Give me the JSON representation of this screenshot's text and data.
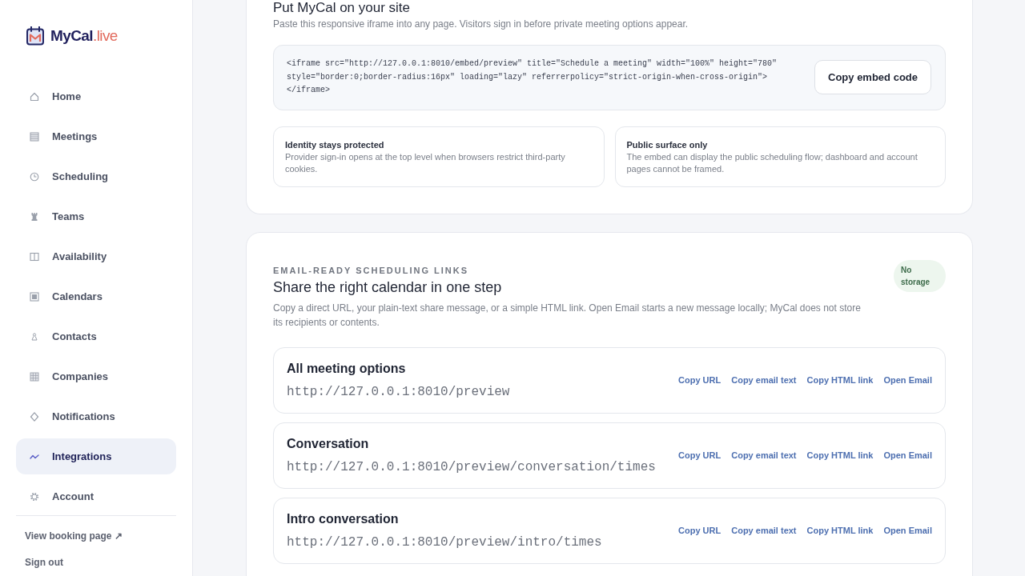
{
  "sidebar": {
    "logo": {
      "name": "MyCal",
      "suffix": ".live"
    },
    "items": [
      {
        "label": "Home",
        "selected": false
      },
      {
        "label": "Meetings",
        "selected": false
      },
      {
        "label": "Scheduling",
        "selected": false
      },
      {
        "label": "Teams",
        "selected": false
      },
      {
        "label": "Availability",
        "selected": false
      },
      {
        "label": "Calendars",
        "selected": false
      },
      {
        "label": "Contacts",
        "selected": false
      },
      {
        "label": "Companies",
        "selected": false
      },
      {
        "label": "Notifications",
        "selected": false
      },
      {
        "label": "Integrations",
        "selected": true
      },
      {
        "label": "Account",
        "selected": false
      }
    ],
    "links": [
      "View booking page ↗",
      "Sign out"
    ]
  },
  "embed": {
    "title": "Put MyCal on your site",
    "description": "Paste this responsive iframe into any page. Visitors sign in before private meeting options appear.",
    "code": "<iframe src=\"http://127.0.0.1:8010/embed/preview\" title=\"Schedule a meeting\" width=\"100%\" height=\"780\" style=\"border:0;border-radius:16px\" loading=\"lazy\" referrerpolicy=\"strict-origin-when-cross-origin\">\n</iframe>",
    "button": "Copy embed code",
    "notes": [
      {
        "title": "Identity stays protected",
        "text": "Provider sign-in opens at the top level when browsers restrict third-party cookies."
      },
      {
        "title": "Public surface only",
        "text": "The embed can display the public scheduling flow; dashboard and account pages cannot be framed."
      }
    ]
  },
  "share": {
    "eyebrow": "EMAIL-READY SCHEDULING LINKS",
    "title": "Share the right calendar in one step",
    "description": "Copy a direct URL, your plain-text share message, or a simple HTML link. Open Email starts a new message locally; MyCal does not store its recipients or contents.",
    "badge": "No storage",
    "rows": [
      {
        "title": "All meeting options",
        "url": "http://127.0.0.1:8010/preview",
        "actions": [
          "Copy URL",
          "Copy email text",
          "Copy HTML link",
          "Open Email"
        ]
      },
      {
        "title": "Conversation",
        "url": "http://127.0.0.1:8010/preview/conversation/times",
        "actions": [
          "Copy URL",
          "Copy email text",
          "Copy HTML link",
          "Open Email"
        ]
      },
      {
        "title": "Intro conversation",
        "url": "http://127.0.0.1:8010/preview/intro/times",
        "actions": [
          "Copy URL",
          "Copy email text",
          "Copy HTML link",
          "Open Email"
        ]
      }
    ]
  }
}
